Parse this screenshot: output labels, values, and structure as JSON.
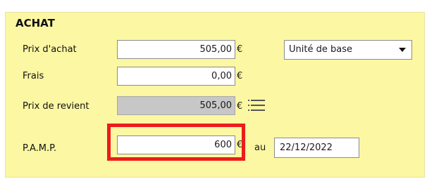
{
  "group": {
    "title": "ACHAT"
  },
  "rows": {
    "prix_achat": {
      "label": "Prix d'achat",
      "value": "505,00",
      "currency": "€"
    },
    "frais": {
      "label": "Frais",
      "value": "0,00",
      "currency": "€"
    },
    "prix_revient": {
      "label": "Prix de revient",
      "value": "505,00",
      "currency": "€"
    },
    "pamp": {
      "label": "P.A.M.P.",
      "value": "600",
      "currency": "€",
      "date_prefix": "au",
      "date": "22/12/2022"
    }
  },
  "unit_select": {
    "value": "Unité de base"
  },
  "colors": {
    "panel_bg": "#fcf7a2",
    "highlight": "#ec1c1c",
    "disabled_field": "#c7c7c7"
  },
  "icons": {
    "list": "list-icon"
  }
}
